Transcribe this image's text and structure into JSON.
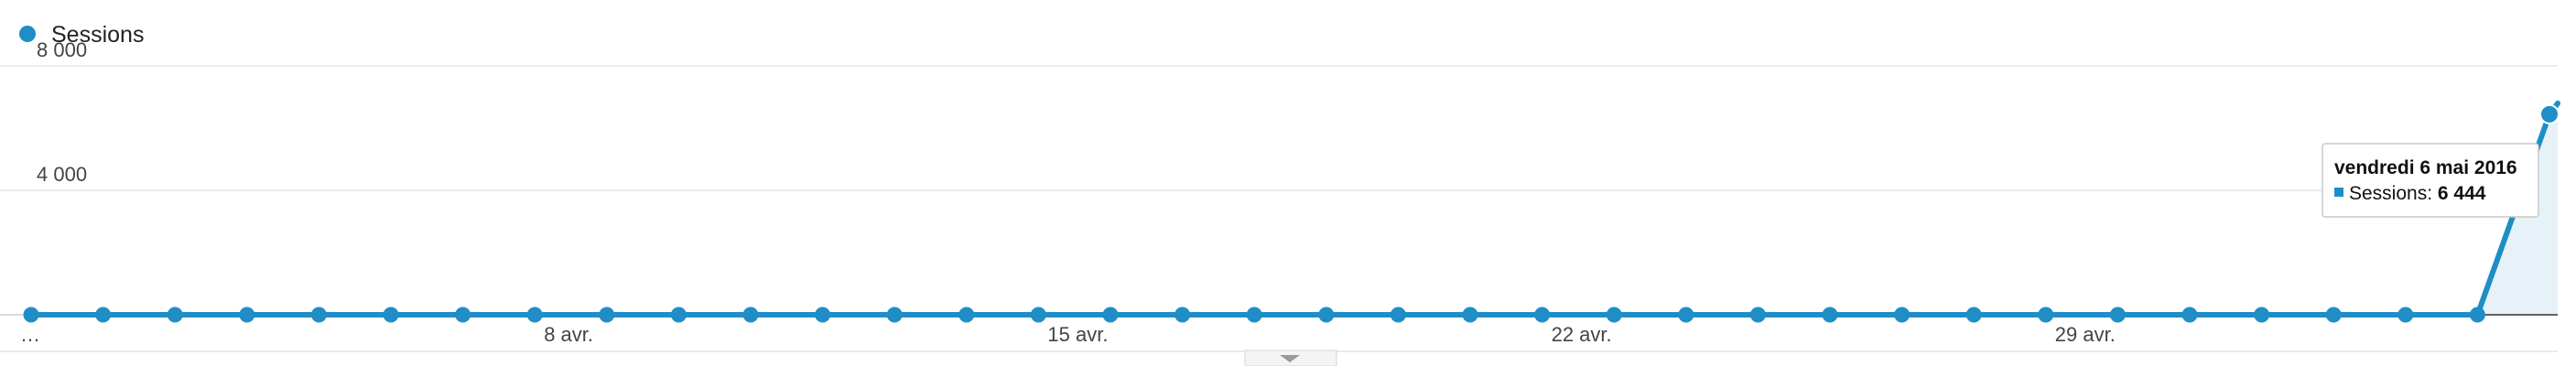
{
  "legend": {
    "label": "Sessions",
    "color": "#1f8ec6"
  },
  "tooltip": {
    "date": "vendredi 6 mai 2016",
    "label": "Sessions:",
    "value": "6 444"
  },
  "chart_data": {
    "type": "line",
    "series": [
      {
        "name": "Sessions",
        "color": "#1f8ec6",
        "values": [
          0,
          0,
          0,
          0,
          0,
          0,
          0,
          0,
          0,
          0,
          0,
          0,
          0,
          0,
          0,
          0,
          0,
          0,
          0,
          0,
          0,
          0,
          0,
          0,
          0,
          0,
          0,
          0,
          0,
          0,
          0,
          0,
          0,
          0,
          0,
          6444
        ]
      }
    ],
    "y_ticks": [
      {
        "value": 4000,
        "label": "4 000"
      },
      {
        "value": 8000,
        "label": "8 000"
      }
    ],
    "x_ticks": [
      {
        "index": 0,
        "label": "…"
      },
      {
        "index": 7,
        "label": "8 avr."
      },
      {
        "index": 14,
        "label": "15 avr."
      },
      {
        "index": 21,
        "label": "22 avr."
      },
      {
        "index": 28,
        "label": "29 avr."
      }
    ],
    "ylim": [
      0,
      8000
    ],
    "grid": true,
    "area_fill_last_segment": true,
    "highlighted_index": 35,
    "legend_position": "top-left"
  }
}
